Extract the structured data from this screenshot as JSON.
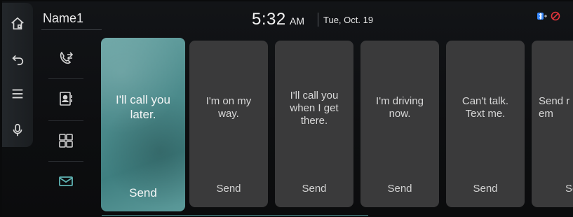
{
  "header": {
    "contact_name": "Name1",
    "time": "5:32",
    "ampm": "AM",
    "date": "Tue, Oct. 19"
  },
  "rail": {
    "items": [
      {
        "name": "home-icon"
      },
      {
        "name": "back-icon"
      },
      {
        "name": "menu-icon"
      },
      {
        "name": "microphone-icon"
      }
    ]
  },
  "side_menu": {
    "items": [
      {
        "name": "call-transfer-icon"
      },
      {
        "name": "contacts-icon"
      },
      {
        "name": "keypad-icon"
      },
      {
        "name": "message-icon",
        "active": true
      }
    ]
  },
  "messages": [
    {
      "text": "I'll call you\nlater.",
      "send": "Send",
      "selected": true
    },
    {
      "text": "I'm on my\nway.",
      "send": "Send"
    },
    {
      "text": "I'll call you\nwhen I get\nthere.",
      "send": "Send"
    },
    {
      "text": "I'm driving\nnow.",
      "send": "Send"
    },
    {
      "text": "Can't talk.\nText me.",
      "send": "Send"
    },
    {
      "text": "Send r\nem",
      "send": "Se"
    }
  ],
  "colors": {
    "accent": "#4d8c8d",
    "bluetooth": "#3a8bff",
    "warning": "#e2343a"
  }
}
